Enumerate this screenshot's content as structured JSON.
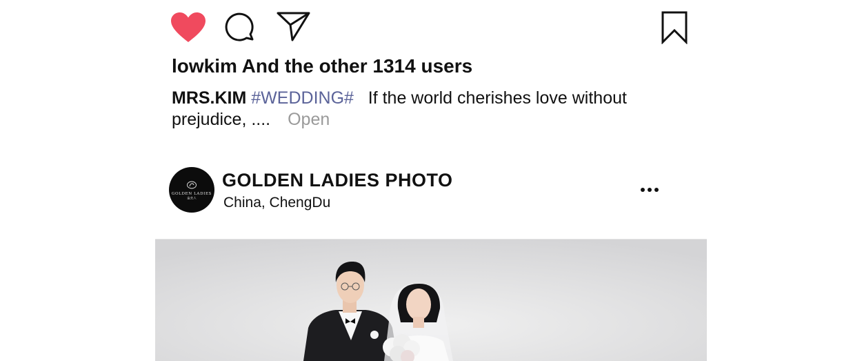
{
  "actions": {
    "like_icon": "heart-filled-icon",
    "comment_icon": "speech-bubble-icon",
    "share_icon": "paper-plane-icon",
    "save_icon": "bookmark-icon",
    "like_color": "#f04a5e"
  },
  "likes": {
    "text": "lowkim And the other 1314 users"
  },
  "caption": {
    "username": "MRS.KIM",
    "hashtag": "#WEDDING#",
    "text": "If the world cherishes love without prejudice, ....",
    "more_label": "Open"
  },
  "post": {
    "account_name": "GOLDEN LADIES PHOTO",
    "location": "China,  ChengDu",
    "avatar_logo_text": "GOLDEN LADIES",
    "avatar_logo_subtext": "金夫人",
    "more_icon": "more-horizontal-icon"
  },
  "photo": {
    "subject": "wedding-portrait",
    "background_color": "#dcdcde"
  }
}
